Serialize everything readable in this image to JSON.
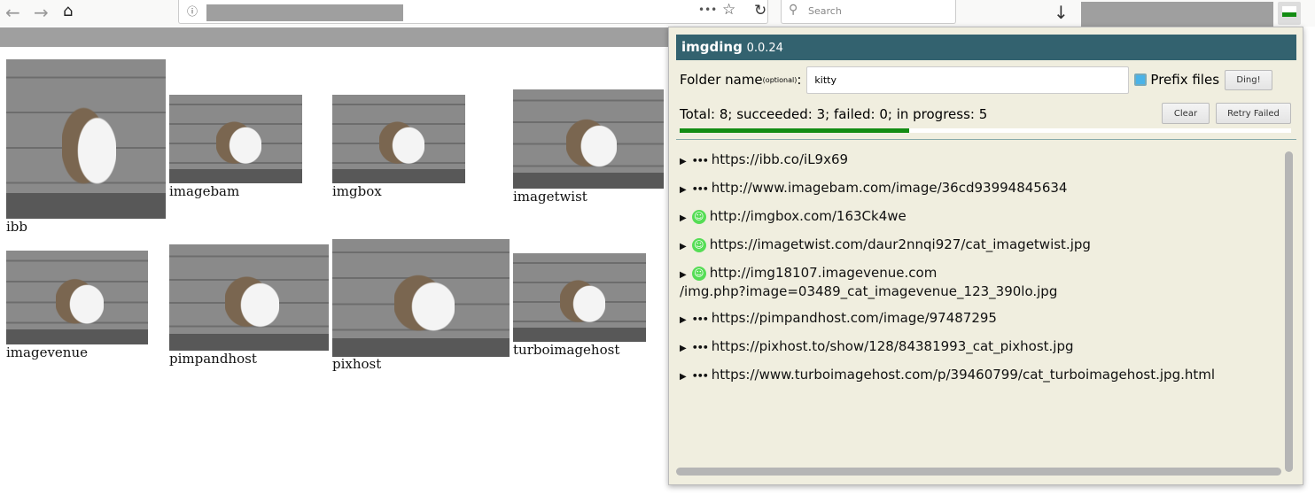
{
  "browser": {
    "search_placeholder": "Search",
    "more_icon": "•••"
  },
  "images": [
    {
      "label": "ibb"
    },
    {
      "label": "imagebam"
    },
    {
      "label": "imgbox"
    },
    {
      "label": "imagetwist"
    },
    {
      "label": "imagevenue"
    },
    {
      "label": "pimpandhost"
    },
    {
      "label": "pixhost"
    },
    {
      "label": "turboimagehost"
    }
  ],
  "popup": {
    "title": "imgding",
    "version": "0.0.24",
    "folder_label": "Folder name",
    "folder_optional": "(optional)",
    "folder_colon": ":",
    "folder_value": "kitty",
    "prefix_label": "Prefix files",
    "prefix_checked": true,
    "ding_label": "Ding!",
    "clear_label": "Clear",
    "retry_label": "Retry Failed",
    "status": "Total: 8; succeeded: 3; failed: 0; in progress: 5",
    "progress_percent": 37.5,
    "progress_color": "#138c13",
    "header_color": "#33626f",
    "items": [
      {
        "state": "in-progress",
        "url": "https://ibb.co/iL9x69"
      },
      {
        "state": "in-progress",
        "url": "http://www.imagebam.com/image/36cd93994845634"
      },
      {
        "state": "success",
        "url": "http://imgbox.com/163Ck4we"
      },
      {
        "state": "success",
        "url": "https://imagetwist.com/daur2nnqi927/cat_imagetwist.jpg"
      },
      {
        "state": "success",
        "url": "http://img18107.imagevenue.com/img.php?image=03489_cat_imagevenue_123_390lo.jpg"
      },
      {
        "state": "in-progress",
        "url": "https://pimpandhost.com/image/97487295"
      },
      {
        "state": "in-progress",
        "url": "https://pixhost.to/show/128/84381993_cat_pixhost.jpg"
      },
      {
        "state": "in-progress",
        "url": "https://www.turboimagehost.com/p/39460799/cat_turboimagehost.jpg.html"
      }
    ]
  }
}
